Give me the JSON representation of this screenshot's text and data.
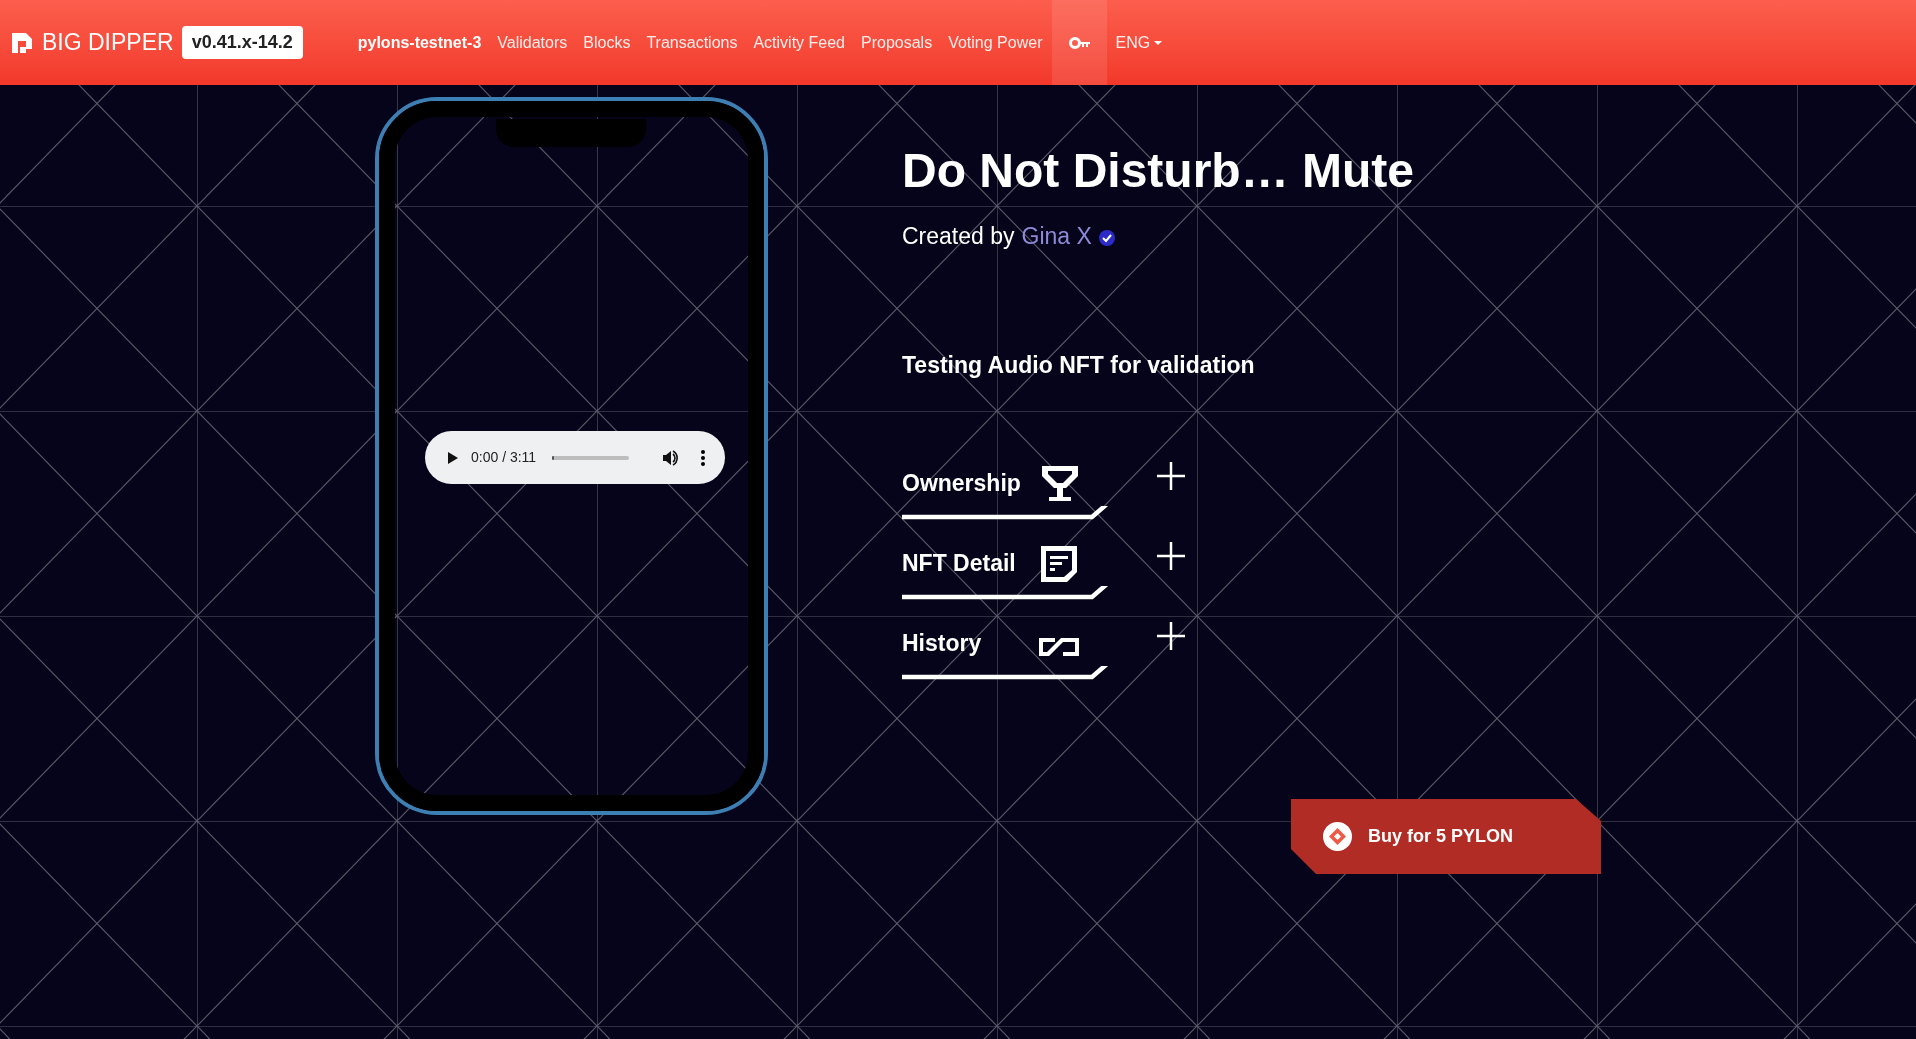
{
  "navbar": {
    "brand": "BIG DIPPER",
    "version": "v0.41.x-14.2",
    "chain_id": "pylons-testnet-3",
    "links": [
      {
        "label": "Validators"
      },
      {
        "label": "Blocks"
      },
      {
        "label": "Transactions"
      },
      {
        "label": "Activity Feed"
      },
      {
        "label": "Proposals"
      },
      {
        "label": "Voting Power"
      }
    ],
    "language": "ENG"
  },
  "audio_player": {
    "time": "0:00 / 3:11",
    "level": 0.02
  },
  "nft": {
    "title": "Do Not Disturb… Mute",
    "created_by_label": "Created by",
    "creator": "Gina X",
    "description": "Testing Audio NFT for validation",
    "sections": [
      {
        "label": "Ownership"
      },
      {
        "label": "NFT Detail"
      },
      {
        "label": "History"
      }
    ],
    "buy_button": "Buy for 5 PYLON"
  }
}
